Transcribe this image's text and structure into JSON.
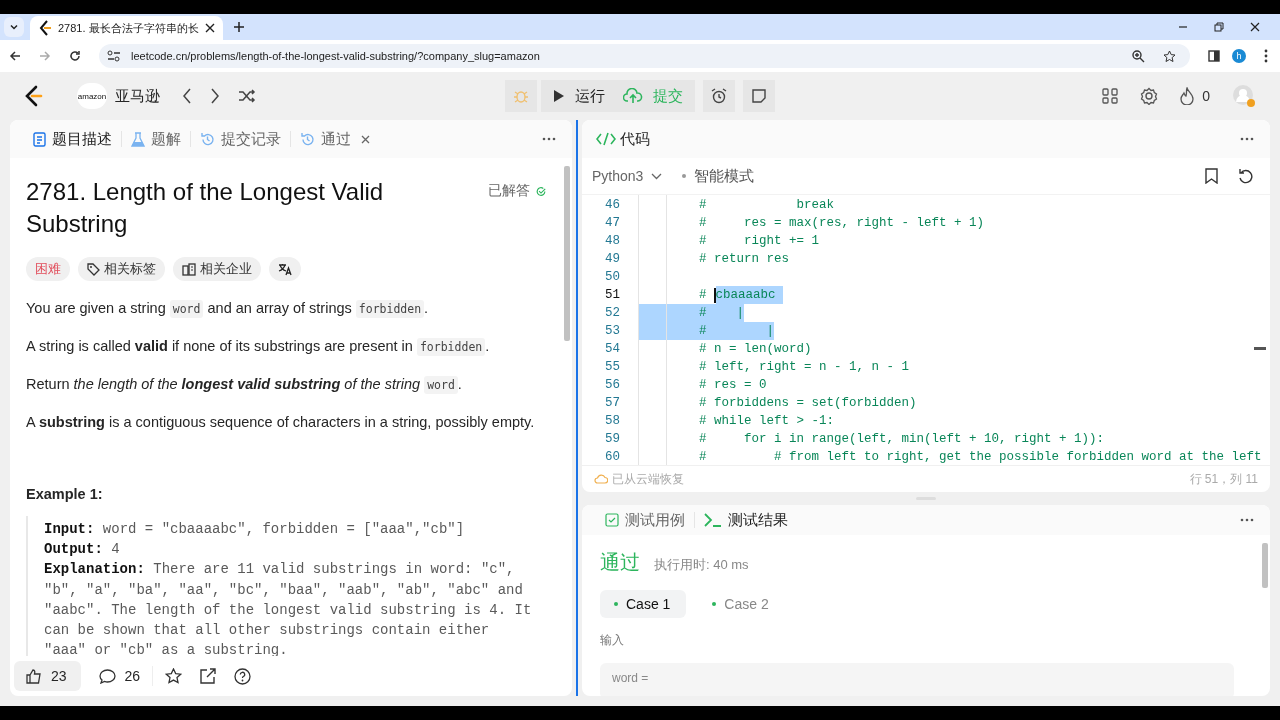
{
  "browser": {
    "tab_title": "2781. 最长合法子字符串的长",
    "url": "leetcode.cn/problems/length-of-the-longest-valid-substring/?company_slug=amazon",
    "profile_initial": "h"
  },
  "navbar": {
    "company_logo": "amazon",
    "company": "亚马逊",
    "run": "运行",
    "submit": "提交",
    "streak": "0"
  },
  "problem": {
    "tabs": [
      {
        "label": "题目描述",
        "selected": true,
        "kind": "doc"
      },
      {
        "label": "题解",
        "selected": false,
        "kind": "flask"
      },
      {
        "label": "提交记录",
        "selected": false,
        "kind": "history"
      },
      {
        "label": "通过",
        "selected": false,
        "kind": "result"
      }
    ],
    "title": "2781. Length of the Longest Valid Substring",
    "status": "已解答",
    "tags": [
      {
        "label": "困难",
        "kind": "difficulty"
      },
      {
        "label": "相关标签",
        "kind": "topics"
      },
      {
        "label": "相关企业",
        "kind": "companies"
      }
    ],
    "paragraphs": [
      [
        {
          "kind": "text",
          "text": "You are given a string "
        },
        {
          "kind": "code",
          "text": "word"
        },
        {
          "kind": "text",
          "text": " and an array of strings "
        },
        {
          "kind": "code",
          "text": "forbidden"
        },
        {
          "kind": "text",
          "text": "."
        }
      ],
      [
        {
          "kind": "text",
          "text": "A string is called **valid** if none of its substrings are present in "
        },
        {
          "kind": "code",
          "text": "forbidden"
        },
        {
          "kind": "text",
          "text": "."
        }
      ],
      [
        {
          "kind": "text",
          "text": "Return *the length of the* "
        },
        {
          "kind": "emphasis",
          "text": "longest valid substring"
        },
        {
          "kind": "text",
          "text": " *of the string* "
        },
        {
          "kind": "code",
          "text": "word"
        },
        {
          "kind": "text",
          "text": "."
        }
      ],
      [
        {
          "kind": "text",
          "text": "A **substring** is a contiguous sequence of characters in a string, possibly empty."
        }
      ]
    ],
    "example": {
      "heading": "Example 1:",
      "lines": [
        {
          "label": "Input:",
          "text": "word = \"cbaaaabc\", forbidden = [\"aaa\",\"cb\"]"
        },
        {
          "label": "Output:",
          "text": "4"
        },
        {
          "label": "Explanation:",
          "text": "There are 11 valid substrings in word: \"c\", \"b\", \"a\", \"ba\", \"aa\", \"bc\", \"baa\", \"aab\", \"ab\", \"abc\" and \"aabc\". The length of the longest valid substring is 4. It can be shown that all other substrings contain either \"aaa\" or \"cb\" as a substring."
        }
      ]
    },
    "likes": "23",
    "comments": "26"
  },
  "code": {
    "title": "代码",
    "language": "Python3",
    "mode": "智能模式",
    "lines": [
      {
        "number": "46",
        "text": "        #            break",
        "active": false
      },
      {
        "number": "47",
        "text": "        #     res = max(res, right - left + 1)",
        "active": false
      },
      {
        "number": "48",
        "text": "        #     right += 1",
        "active": false
      },
      {
        "number": "49",
        "text": "        # return res",
        "active": false
      },
      {
        "number": "50",
        "active": false
      },
      {
        "number": "51",
        "text": "        # ",
        "selected_text": "cbaaaabc ",
        "active": true
      },
      {
        "number": "52",
        "selected_text": "        #    |",
        "active": false
      },
      {
        "number": "53",
        "selected_text": "        #        |",
        "active": false
      },
      {
        "number": "54",
        "text": "        # n = len(word)",
        "active": false
      },
      {
        "number": "55",
        "text": "        # left, right = n - 1, n - 1",
        "active": false
      },
      {
        "number": "56",
        "text": "        # res = 0",
        "active": false
      },
      {
        "number": "57",
        "text": "        # forbiddens = set(forbidden)",
        "active": false
      },
      {
        "number": "58",
        "text": "        # while left > -1:",
        "active": false
      },
      {
        "number": "59",
        "text": "        #     for i in range(left, min(left + 10, right + 1)):",
        "active": false
      },
      {
        "number": "60",
        "text": "        #         # from left to right, get the possible forbidden word at the left",
        "active": false
      }
    ],
    "saved": "已从云端恢复",
    "cursor": "行 51，列 11"
  },
  "tests": {
    "tabs": [
      {
        "label": "测试用例",
        "selected": false,
        "kind": "cases"
      },
      {
        "label": "测试结果",
        "selected": true,
        "kind": "result"
      }
    ],
    "verdict": "通过",
    "runtime": "执行用时: 40 ms",
    "cases": [
      {
        "label": "Case 1",
        "selected": true
      },
      {
        "label": "Case 2",
        "selected": false
      }
    ],
    "input_label": "输入",
    "input_value": "word ="
  }
}
